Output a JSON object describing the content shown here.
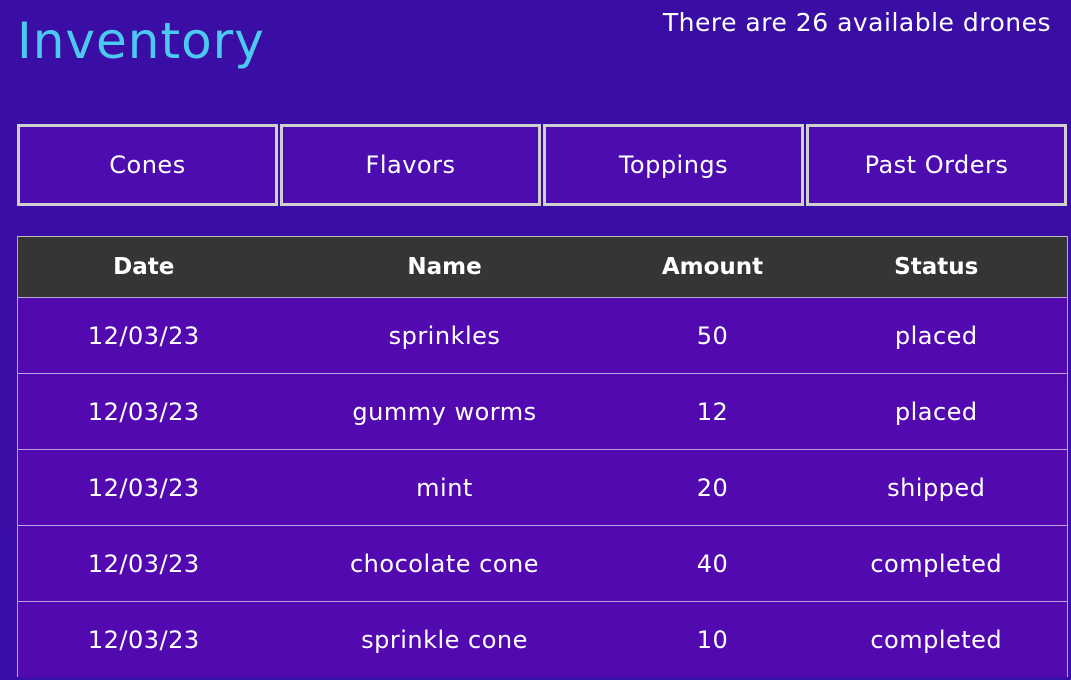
{
  "header": {
    "title": "Inventory",
    "drones_status": "There are 26 available drones"
  },
  "tabs": [
    {
      "label": "Cones"
    },
    {
      "label": "Flavors"
    },
    {
      "label": "Toppings"
    },
    {
      "label": "Past Orders"
    }
  ],
  "table": {
    "columns": [
      "Date",
      "Name",
      "Amount",
      "Status"
    ],
    "rows": [
      {
        "date": "12/03/23",
        "name": "sprinkles",
        "amount": "50",
        "status": "placed"
      },
      {
        "date": "12/03/23",
        "name": "gummy worms",
        "amount": "12",
        "status": "placed"
      },
      {
        "date": "12/03/23",
        "name": "mint",
        "amount": "20",
        "status": "shipped"
      },
      {
        "date": "12/03/23",
        "name": "chocolate cone",
        "amount": "40",
        "status": "completed"
      },
      {
        "date": "12/03/23",
        "name": "sprinkle cone",
        "amount": "10",
        "status": "completed"
      }
    ]
  },
  "colors": {
    "background": "#3a0ea5",
    "title": "#4cc9f0",
    "tab_background": "#4d0cb0",
    "table_header": "#353535",
    "table_row": "#5209b0"
  }
}
